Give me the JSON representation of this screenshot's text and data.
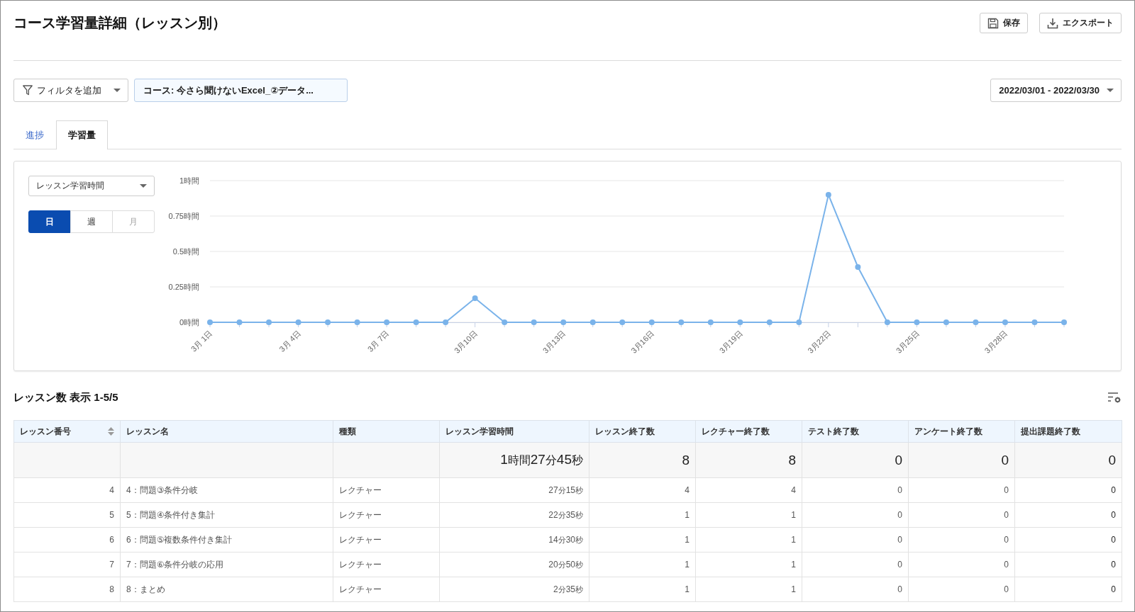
{
  "header": {
    "title": "コース学習量詳細（レッスン別）",
    "buttons": [
      {
        "kind": "save",
        "label": "保存"
      },
      {
        "kind": "export",
        "label": "エクスポート"
      }
    ]
  },
  "filters": {
    "add_filter": "フィルタを追加",
    "chips": [
      "コース: 今さら聞けないExcel_②データ..."
    ],
    "date_range": "2022/03/01 - 2022/03/30"
  },
  "tabs": [
    {
      "label": "進捗",
      "selected": false
    },
    {
      "label": "学習量",
      "selected": true
    }
  ],
  "chart_panel": {
    "metric_select": "レッスン学習時間",
    "periods": [
      {
        "label": "日",
        "selected": true,
        "disabled": false
      },
      {
        "label": "週",
        "selected": false,
        "disabled": false
      },
      {
        "label": "月",
        "selected": false,
        "disabled": true
      }
    ],
    "chart_data": {
      "type": "line",
      "categories": [
        "3月 1日",
        null,
        null,
        "3月 4日",
        null,
        null,
        "3月 7日",
        null,
        null,
        "3月10日",
        null,
        null,
        "3月13日",
        null,
        null,
        "3月16日",
        null,
        null,
        "3月19日",
        null,
        null,
        "3月22日",
        null,
        null,
        "3月25日",
        null,
        null,
        "3月28日",
        null,
        null
      ],
      "values": [
        0,
        0,
        0,
        0,
        0,
        0,
        0,
        0,
        0,
        0.17,
        0,
        0,
        0,
        0,
        0,
        0,
        0,
        0,
        0,
        0,
        0,
        0.9,
        0.39,
        0,
        0,
        0,
        0,
        0,
        0,
        0
      ],
      "color": "#7ab3ea",
      "ylim": [
        0,
        1
      ],
      "yticks": [
        {
          "value": 0,
          "label": "0時間"
        },
        {
          "value": 0.25,
          "label": "0.25時間"
        },
        {
          "value": 0.5,
          "label": "0.5時間"
        },
        {
          "value": 0.75,
          "label": "0.75時間"
        },
        {
          "value": 1,
          "label": "1時間"
        }
      ],
      "grid": true,
      "marker": "circle"
    }
  },
  "table": {
    "heading": "レッスン数 表示 1-5/5",
    "columns": [
      {
        "label": "レッスン番号",
        "sortable": true
      },
      {
        "label": "レッスン名",
        "sortable": false
      },
      {
        "label": "種類",
        "sortable": false
      },
      {
        "label": "レッスン学習時間",
        "sortable": false
      },
      {
        "label": "レッスン終了数",
        "sortable": false
      },
      {
        "label": "レクチャー終了数",
        "sortable": false
      },
      {
        "label": "テスト終了数",
        "sortable": false
      },
      {
        "label": "アンケート終了数",
        "sortable": false
      },
      {
        "label": "提出課題終了数",
        "sortable": false
      }
    ],
    "totals": [
      "1時間27分45秒",
      "8",
      "8",
      "0",
      "0",
      "0"
    ],
    "rows": [
      {
        "number": "4",
        "name": "4：問題③条件分岐",
        "type": "レクチャー",
        "study_time": "27分15秒",
        "counts": [
          "4",
          "4",
          "0",
          "0",
          "0"
        ]
      },
      {
        "number": "5",
        "name": "5：問題④条件付き集計",
        "type": "レクチャー",
        "study_time": "22分35秒",
        "counts": [
          "1",
          "1",
          "0",
          "0",
          "0"
        ]
      },
      {
        "number": "6",
        "name": "6：問題⑤複数条件付き集計",
        "type": "レクチャー",
        "study_time": "14分30秒",
        "counts": [
          "1",
          "1",
          "0",
          "0",
          "0"
        ]
      },
      {
        "number": "7",
        "name": "7：問題⑥条件分岐の応用",
        "type": "レクチャー",
        "study_time": "20分50秒",
        "counts": [
          "1",
          "1",
          "0",
          "0",
          "0"
        ]
      },
      {
        "number": "8",
        "name": "8：まとめ",
        "type": "レクチャー",
        "study_time": "2分35秒",
        "counts": [
          "1",
          "1",
          "0",
          "0",
          "0"
        ]
      }
    ]
  }
}
